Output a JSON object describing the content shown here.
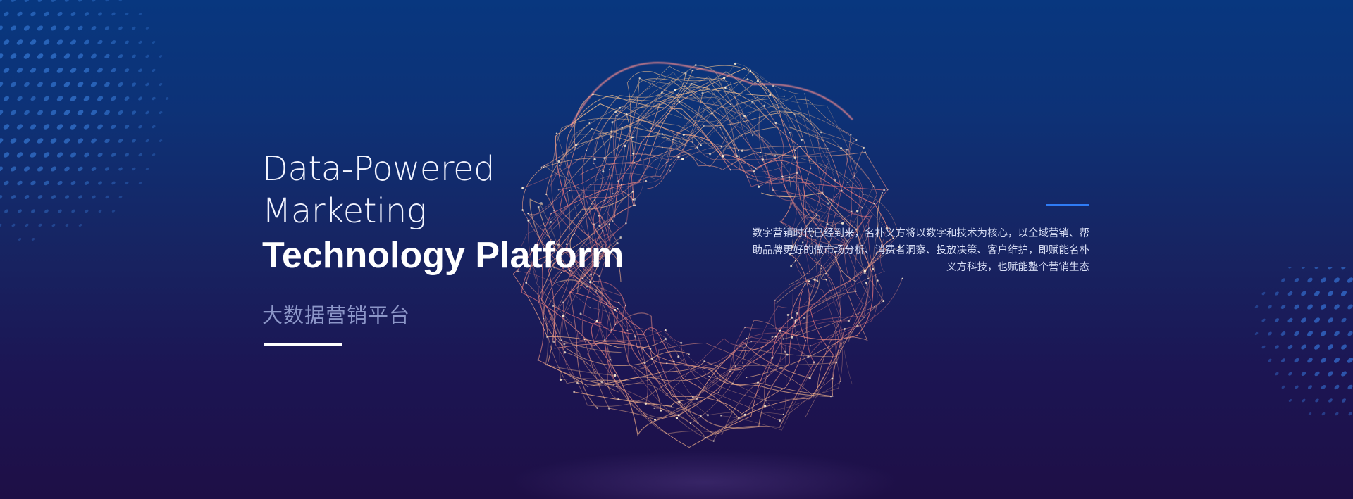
{
  "hero": {
    "title_line1": "Data-Powered",
    "title_line2": "Marketing",
    "title_line3": "Technology Platform",
    "subtitle_cn": "大数据营销平台",
    "description": "数字营销时代已经到来，名朴义方将以数字和技术为核心，以全域营销、帮助品牌更好的做市场分析、消费者洞察、投放决策、客户维护，即赋能名朴义方科技，也赋能整个营销生态"
  },
  "colors": {
    "background_top": "#08377f",
    "background_bottom": "#1e0f46",
    "accent_blue": "#2f7cf5",
    "particle_warm": "#f7c58f",
    "particle_pink": "#e6707a"
  },
  "decorations": {
    "dot_pattern_top_left": "halftone-dots",
    "dot_pattern_bottom_right": "halftone-dots",
    "center_graphic": "particle-sphere"
  }
}
